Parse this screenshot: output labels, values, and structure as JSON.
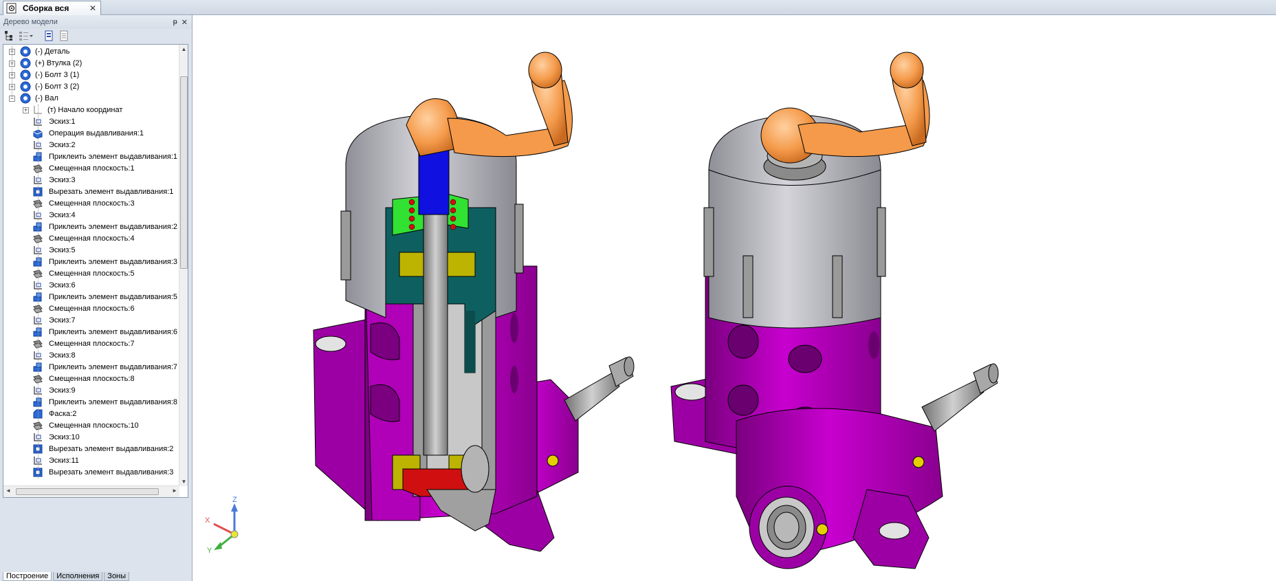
{
  "document": {
    "tab_title": "Сборка вся",
    "close_glyph": "✕"
  },
  "panel": {
    "title": "Дерево модели",
    "pin_glyph": "ᵽ",
    "close_glyph": "✕"
  },
  "tree": {
    "top_items": [
      {
        "label": "(-) Деталь",
        "icon": "part-icon"
      },
      {
        "label": "(+) Втулка (2)",
        "icon": "part-icon"
      },
      {
        "label": "(-) Болт 3 (1)",
        "icon": "part-icon"
      },
      {
        "label": "(-) Болт 3 (2)",
        "icon": "part-icon"
      },
      {
        "label": "(-) Вал",
        "icon": "part-icon"
      }
    ],
    "origin": {
      "label": "(т) Начало координат",
      "icon": "origin-icon"
    },
    "children": [
      {
        "label": "Эскиз:1",
        "icon": "sketch-icon"
      },
      {
        "label": "Операция выдавливания:1",
        "icon": "extrude-icon"
      },
      {
        "label": "Эскиз:2",
        "icon": "sketch-icon"
      },
      {
        "label": "Приклеить элемент выдавливания:1",
        "icon": "boss-extrude-icon"
      },
      {
        "label": "Смещенная плоскость:1",
        "icon": "offset-plane-icon"
      },
      {
        "label": "Эскиз:3",
        "icon": "sketch-icon"
      },
      {
        "label": "Вырезать элемент выдавливания:1",
        "icon": "cut-extrude-icon"
      },
      {
        "label": "Смещенная плоскость:3",
        "icon": "offset-plane-icon"
      },
      {
        "label": "Эскиз:4",
        "icon": "sketch-icon"
      },
      {
        "label": "Приклеить элемент выдавливания:2",
        "icon": "boss-extrude-icon"
      },
      {
        "label": "Смещенная плоскость:4",
        "icon": "offset-plane-icon"
      },
      {
        "label": "Эскиз:5",
        "icon": "sketch-icon"
      },
      {
        "label": "Приклеить элемент выдавливания:3",
        "icon": "boss-extrude-icon"
      },
      {
        "label": "Смещенная плоскость:5",
        "icon": "offset-plane-icon"
      },
      {
        "label": "Эскиз:6",
        "icon": "sketch-icon"
      },
      {
        "label": "Приклеить элемент выдавливания:5",
        "icon": "boss-extrude-icon"
      },
      {
        "label": "Смещенная плоскость:6",
        "icon": "offset-plane-icon"
      },
      {
        "label": "Эскиз:7",
        "icon": "sketch-icon"
      },
      {
        "label": "Приклеить элемент выдавливания:6",
        "icon": "boss-extrude-icon"
      },
      {
        "label": "Смещенная плоскость:7",
        "icon": "offset-plane-icon"
      },
      {
        "label": "Эскиз:8",
        "icon": "sketch-icon"
      },
      {
        "label": "Приклеить элемент выдавливания:7",
        "icon": "boss-extrude-icon"
      },
      {
        "label": "Смещенная плоскость:8",
        "icon": "offset-plane-icon"
      },
      {
        "label": "Эскиз:9",
        "icon": "sketch-icon"
      },
      {
        "label": "Приклеить элемент выдавливания:8",
        "icon": "boss-extrude-icon"
      },
      {
        "label": "Фаска:2",
        "icon": "chamfer-icon"
      },
      {
        "label": "Смещенная плоскость:10",
        "icon": "offset-plane-icon"
      },
      {
        "label": "Эскиз:10",
        "icon": "sketch-icon"
      },
      {
        "label": "Вырезать элемент выдавливания:2",
        "icon": "cut-extrude-icon"
      },
      {
        "label": "Эскиз:11",
        "icon": "sketch-icon"
      },
      {
        "label": "Вырезать элемент выдавливания:3",
        "icon": "cut-extrude-icon"
      }
    ]
  },
  "bottom_tabs": [
    "Построение",
    "Исполнения",
    "Зоны"
  ],
  "triad": {
    "x": "X",
    "y": "Y",
    "z": "Z"
  },
  "colors": {
    "body": "#b000b8",
    "cap": "#a9a9b1",
    "handle": "#f49a4a",
    "shaft": "#1010e0",
    "spring": "#d01010",
    "bushing": "#bcb400",
    "inner": "#0e6060",
    "green": "#32e232"
  }
}
